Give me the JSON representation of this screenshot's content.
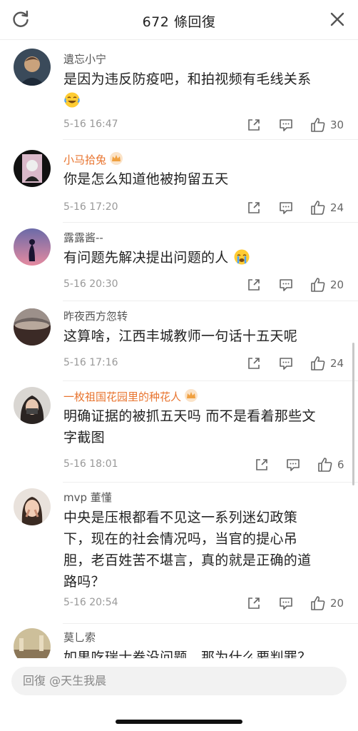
{
  "header": {
    "title": "672 條回復"
  },
  "comments": [
    {
      "name": "遺忘小宁",
      "vip": false,
      "lines": [
        "是因为违反防疫吧，和拍视频有毛线关系"
      ],
      "emoji": "laugh-cry",
      "time": "5-16 16:47",
      "likes": "30"
    },
    {
      "name": "小马拾兔",
      "vip": true,
      "lines": [
        "你是怎么知道他被拘留五天"
      ],
      "emoji": "",
      "time": "5-16 17:20",
      "likes": "24"
    },
    {
      "name": "露露酱--",
      "vip": false,
      "lines": [
        "有问题先解决提出问题的人"
      ],
      "emoji": "crying",
      "time": "5-16 20:30",
      "likes": "20"
    },
    {
      "name": "昨夜西方忽转",
      "vip": false,
      "lines": [
        "这算啥，江西丰城教师一句话十五天呢"
      ],
      "emoji": "",
      "time": "5-16 17:16",
      "likes": "24"
    },
    {
      "name": "一枚祖国花园里的种花人",
      "vip": true,
      "lines": [
        "明确证据的被抓五天吗 而不是看着那些文",
        "字截图"
      ],
      "emoji": "",
      "time": "5-16 18:01",
      "likes": "6"
    },
    {
      "name": "mvp 董懂",
      "vip": false,
      "lines": [
        "中央是压根都看不见这一系列迷幻政策",
        "下，现在的社会情况吗，当官的提心吊",
        "胆，老百姓苦不堪言，真的就是正确的道",
        "路吗？"
      ],
      "emoji": "",
      "time": "5-16 20:54",
      "likes": "20"
    },
    {
      "name": "莫乚索",
      "vip": false,
      "lines": [
        "如果吃瑞士卷没问题，那为什么要判罪？"
      ],
      "emoji": "",
      "time": "",
      "likes": ""
    }
  ],
  "reply": {
    "placeholder": "回復 @天生我晨"
  },
  "colors": {
    "vip_name": "#e8742f",
    "text": "#222222",
    "meta": "#999999"
  }
}
